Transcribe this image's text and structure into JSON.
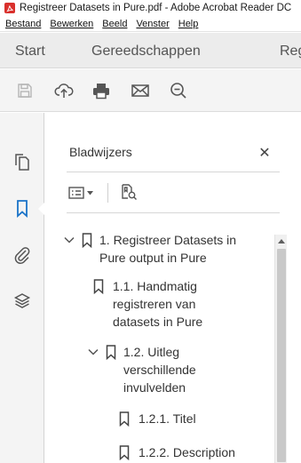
{
  "window": {
    "title": "Registreer Datasets in Pure.pdf - Adobe Acrobat Reader DC",
    "app_icon": "acrobat-pdf-icon"
  },
  "menubar": {
    "items": [
      "Bestand",
      "Bewerken",
      "Beeld",
      "Venster",
      "Help"
    ]
  },
  "tabs": {
    "start": "Start",
    "tools": "Gereedschappen",
    "document": "Registreer Datasets in Pure.pdf"
  },
  "toolbar": {
    "icons": [
      "save-icon",
      "cloud-upload-icon",
      "print-icon",
      "email-icon",
      "zoom-out-icon"
    ]
  },
  "leftrail": {
    "icons": [
      "page-thumbnails-icon",
      "bookmarks-icon",
      "attachments-icon",
      "layers-icon"
    ]
  },
  "bookmarks_panel": {
    "title": "Bladwijzers",
    "close_symbol": "✕",
    "items": [
      {
        "label_lines": [
          "1. Registreer Datasets in",
          "Pure output in Pure"
        ],
        "expanded": true,
        "level": 0
      },
      {
        "label_lines": [
          "1.1. Handmatig",
          "registreren van",
          "datasets in Pure"
        ],
        "expanded": false,
        "level": 1
      },
      {
        "label_lines": [
          "1.2. Uitleg",
          "verschillende",
          "invulvelden"
        ],
        "expanded": true,
        "level": 1
      },
      {
        "label_lines": [
          "1.2.1. Titel"
        ],
        "expanded": false,
        "level": 2
      },
      {
        "label_lines": [
          "1.2.2. Description"
        ],
        "expanded": false,
        "level": 2
      }
    ]
  },
  "colors": {
    "accent": "#1a73c8",
    "pdf_red": "#d9302c",
    "tab_bg": "#ececec",
    "toolbar_bg": "#f4f4f4"
  }
}
